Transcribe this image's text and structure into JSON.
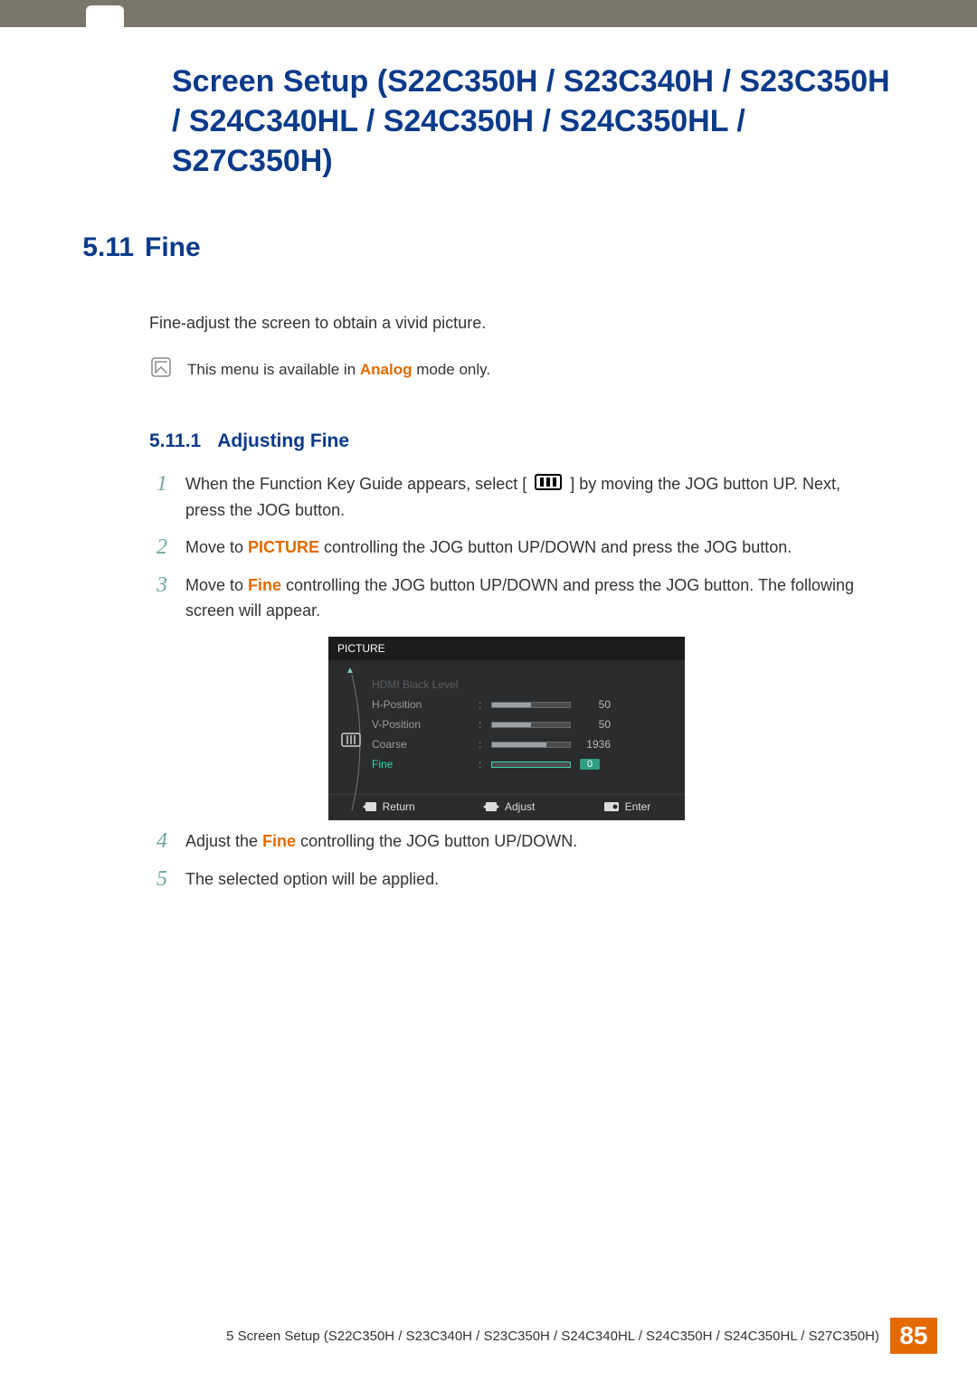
{
  "chapter_title": "Screen Setup (S22C350H / S23C340H / S23C350H / S24C340HL / S24C350H / S24C350HL / S27C350H)",
  "section": {
    "number": "5.11",
    "title": "Fine"
  },
  "intro_text": "Fine-adjust the screen to obtain a vivid picture.",
  "note": {
    "prefix": "This menu is available in ",
    "accent": "Analog",
    "suffix": " mode only."
  },
  "subsection": {
    "number": "5.11.1",
    "title": "Adjusting Fine"
  },
  "steps": {
    "s1": {
      "num": "1",
      "pre": "When the Function Key Guide appears, select [",
      "post": "] by moving the JOG button UP. Next, press the JOG button."
    },
    "s2": {
      "num": "2",
      "pre": "Move to ",
      "accent": "PICTURE",
      "post": " controlling the JOG button UP/DOWN and press the JOG button."
    },
    "s3": {
      "num": "3",
      "pre": "Move to ",
      "accent": "Fine",
      "post": " controlling the JOG button UP/DOWN and press the JOG button. The following screen will appear."
    },
    "s4": {
      "num": "4",
      "pre": "Adjust the ",
      "accent": "Fine",
      "post": " controlling the JOG button UP/DOWN."
    },
    "s5": {
      "num": "5",
      "text": "The selected option will be applied."
    }
  },
  "osd": {
    "title": "PICTURE",
    "items": [
      {
        "label": "HDMI Black Level",
        "disabled": true
      },
      {
        "label": "H-Position",
        "value": "50",
        "fill": 50
      },
      {
        "label": "V-Position",
        "value": "50",
        "fill": 50
      },
      {
        "label": "Coarse",
        "value": "1936",
        "fill": 70
      },
      {
        "label": "Fine",
        "value": "0",
        "fill": 0,
        "active": true
      }
    ],
    "footer": {
      "return": "Return",
      "adjust": "Adjust",
      "enter": "Enter"
    }
  },
  "footer": {
    "text": "5 Screen Setup (S22C350H / S23C340H / S23C350H / S24C340HL / S24C350H / S24C350HL / S27C350H)",
    "page": "85"
  }
}
